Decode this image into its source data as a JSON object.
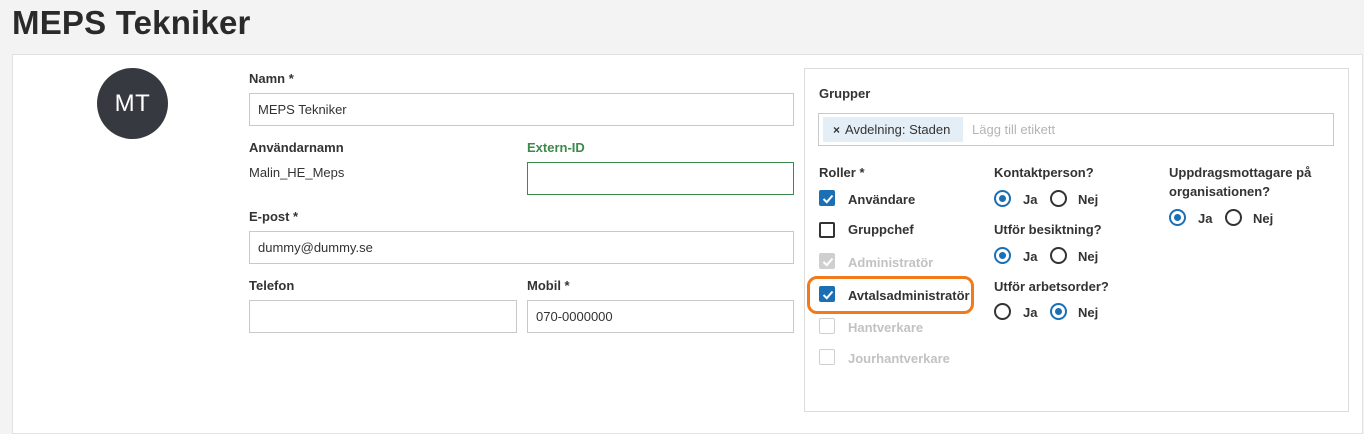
{
  "page": {
    "title": "MEPS Tekniker"
  },
  "avatar": {
    "initials": "MT"
  },
  "form": {
    "name_label": "Namn *",
    "name_value": "MEPS Tekniker",
    "username_label": "Användarnamn",
    "username_value": "Malin_HE_Meps",
    "extern_id_label": "Extern-ID",
    "extern_id_value": "",
    "email_label": "E-post *",
    "email_value": "dummy@dummy.se",
    "phone_label": "Telefon",
    "phone_value": "",
    "mobile_label": "Mobil *",
    "mobile_value": "070-0000000"
  },
  "groups": {
    "label": "Grupper",
    "tags": [
      "Avdelning: Staden"
    ],
    "remove_symbol": "×",
    "placeholder": "Lägg till etikett"
  },
  "roles": {
    "label": "Roller *",
    "items": [
      {
        "label": "Användare",
        "checked": true,
        "disabled": false
      },
      {
        "label": "Gruppchef",
        "checked": false,
        "disabled": false
      },
      {
        "label": "Administratör",
        "checked": true,
        "disabled": true
      },
      {
        "label": "Avtalsadministratör",
        "checked": true,
        "disabled": false
      },
      {
        "label": "Hantverkare",
        "checked": false,
        "disabled": true
      },
      {
        "label": "Jourhantverkare",
        "checked": false,
        "disabled": true
      }
    ]
  },
  "questions": {
    "contact": {
      "label": "Kontaktperson?",
      "yes": "Ja",
      "no": "Nej",
      "selected": "Ja"
    },
    "inspection": {
      "label": "Utför besiktning?",
      "yes": "Ja",
      "no": "Nej",
      "selected": "Ja"
    },
    "workorder": {
      "label": "Utför arbetsorder?",
      "yes": "Ja",
      "no": "Nej",
      "selected": "Nej"
    },
    "assignee_line1": "Uppdragsmottagare på",
    "assignee_line2": "organisationen?",
    "assignee": {
      "yes": "Ja",
      "no": "Nej",
      "selected": "Ja"
    }
  },
  "colors": {
    "accent": "#1a6fb5",
    "highlight": "#f27a1a",
    "extern_id": "#3b8a4a"
  }
}
